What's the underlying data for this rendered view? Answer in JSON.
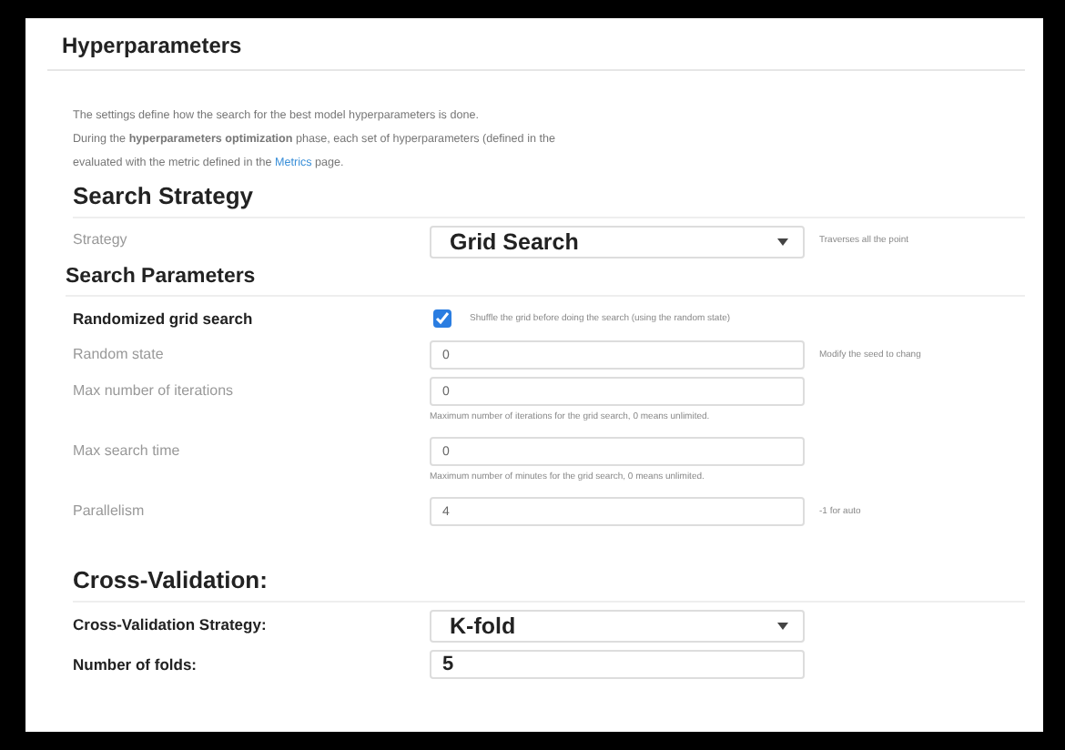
{
  "title": "Hyperparameters",
  "description": [
    {
      "text": "The settings define how the search for the best model hyperparameters is done."
    },
    {
      "text": "During the **hyperparameters optimization** phase, each set of hyperparameters (defined in the"
    },
    {
      "text": "evaluated with the metric defined in the ",
      "link": "Metrics",
      "after": " page."
    }
  ],
  "sections": [
    {
      "heading": "Search Strategy",
      "kind": "major",
      "rows": [
        {
          "kind": "select",
          "label": "Strategy",
          "value": "Grid Search",
          "strong": false,
          "hint": {
            "text": "Traverses all the point",
            "kind": "side"
          }
        }
      ]
    },
    {
      "heading": "Search Parameters",
      "kind": "minor",
      "rows": [
        {
          "kind": "checkbox",
          "label": "Randomized grid search",
          "checked": true,
          "strong": true,
          "hint": {
            "text": "Shuffle the grid before doing the search (using the random state)"
          }
        },
        {
          "kind": "input",
          "label": "Random state",
          "value": "0",
          "strong": false,
          "hint": {
            "text": "Modify the seed to chang",
            "kind": "side"
          }
        },
        {
          "kind": "input",
          "label": "Max number of iterations",
          "value": "0",
          "strong": false,
          "hint": {
            "text": "Maximum number of iterations for the grid search, 0 means unlimited.",
            "kind": "below"
          }
        },
        {
          "kind": "input",
          "label": "Max search time",
          "value": "0",
          "strong": false,
          "hint": {
            "text": "Maximum number of minutes for the grid search, 0 means unlimited.",
            "kind": "below"
          }
        },
        {
          "kind": "input",
          "label": "Parallelism",
          "value": "4",
          "strong": false,
          "hint": {
            "text": "-1 for auto",
            "kind": "side"
          }
        }
      ]
    },
    {
      "heading": "Cross-Validation:",
      "kind": "major",
      "rows": [
        {
          "kind": "select",
          "label": "Cross-Validation Strategy:",
          "value": "K-fold",
          "strong": true
        },
        {
          "kind": "input",
          "label": "Number of folds:",
          "value": "5",
          "strong": true
        }
      ]
    }
  ]
}
